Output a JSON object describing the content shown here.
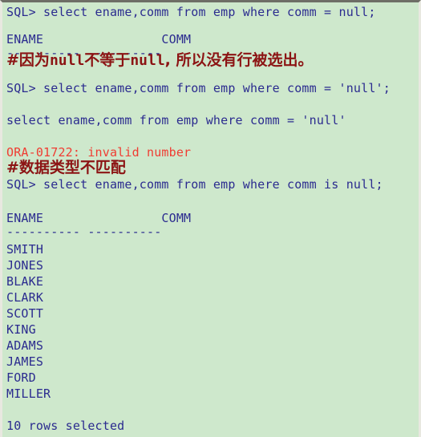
{
  "terminal": {
    "app": "sql-plus-console",
    "background_color": "#cee8cc",
    "sql_text_color": "#2b2b8f",
    "error_text_color": "#f03c32",
    "comment_text_color": "#8c1414",
    "border_top_color": "#6e6e66",
    "border_side_color": "#e8e8e0"
  },
  "lines": {
    "l01_prompt_eq_null": "SQL> select ename,comm from emp where comm = null;",
    "l02_blank": "",
    "l03_header_1": "ENAME                COMM",
    "l04_dashes_1": "---------- ----------",
    "l05_comment_cn_1_hash": "#",
    "l05_comment_cn_1_part1": "因为",
    "l05_comment_cn_1_lat1": "null",
    "l05_comment_cn_1_part2": "不等于",
    "l05_comment_cn_1_lat2": "null",
    "l05_comment_cn_1_part3": ", 所以没有行被选出。",
    "l06_prompt_eq_quoted_null": "SQL> select ename,comm from emp where comm = 'null';",
    "l07_blank": "",
    "l08_echo_statement": "select ename,comm from emp where comm = 'null'",
    "l09_blank": "",
    "l10_error": "ORA-01722: invalid number",
    "l11_comment_cn_2": "#数据类型不匹配",
    "l12_prompt_is_null": "SQL> select ename,comm from emp where comm is null;",
    "l13_blank": "",
    "l14_header_2": "ENAME                COMM",
    "l15_dashes_2": "---------- ----------",
    "l16_footer_blank": "",
    "l17_rows_selected": "10 rows selected"
  },
  "result_rows": [
    "SMITH",
    "JONES",
    "BLAKE",
    "CLARK",
    "SCOTT",
    "KING",
    "ADAMS",
    "JAMES",
    "FORD",
    "MILLER"
  ]
}
